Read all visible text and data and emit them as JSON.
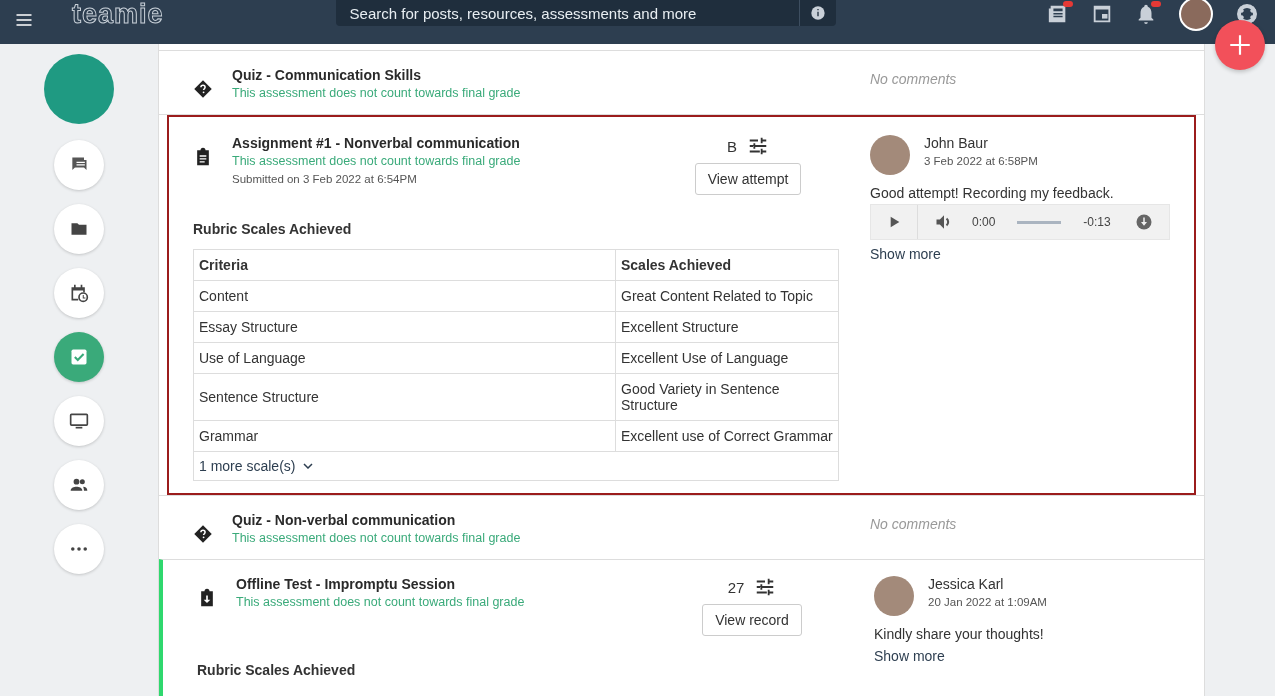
{
  "topbar": {
    "logo": "teamie",
    "search": {
      "placeholder": "Search for posts, resources, assessments and more"
    },
    "icons": [
      {
        "kind": "news",
        "badge": true
      },
      {
        "kind": "window"
      },
      {
        "kind": "bell",
        "badge": true
      },
      {
        "kind": "avatar"
      },
      {
        "kind": "help"
      }
    ]
  },
  "sidebar": {
    "items": [
      {
        "kind": "chat",
        "selected": false
      },
      {
        "kind": "folder",
        "selected": false
      },
      {
        "kind": "calendar",
        "selected": false
      },
      {
        "kind": "check",
        "selected": true
      },
      {
        "kind": "monitor",
        "selected": false
      },
      {
        "kind": "people",
        "selected": false
      },
      {
        "kind": "more",
        "selected": false
      }
    ]
  },
  "assessments": [
    {
      "kind": "quiz",
      "title": "Quiz - Communication Skills",
      "note": "This assessment does not count towards final grade",
      "highlighted": false,
      "accent": false,
      "no_comments": "No comments"
    },
    {
      "kind": "assignment",
      "title": "Assignment #1 - Nonverbal communication",
      "note": "This assessment does not count towards final grade",
      "submitted": "Submitted on 3 Feb 2022 at 6:54PM",
      "grade": "B",
      "action": "View attempt",
      "highlighted": true,
      "accent": false,
      "rubric": {
        "heading": "Rubric Scales Achieved",
        "columns": [
          "Criteria",
          "Scales Achieved"
        ],
        "rows": [
          [
            "Content",
            "Great Content Related to Topic"
          ],
          [
            "Essay Structure",
            "Excellent Structure"
          ],
          [
            "Use of Language",
            "Excellent Use of Language"
          ],
          [
            "Sentence Structure",
            "Good Variety in Sentence Structure"
          ],
          [
            "Grammar",
            "Excellent use of Correct Grammar"
          ]
        ],
        "more": "1 more scale(s)"
      },
      "comment": {
        "author": "John Baur",
        "time": "3 Feb 2022 at 6:58PM",
        "text": "Good attempt! Recording my feedback.",
        "audio": {
          "current": "0:00",
          "remaining": "-0:13"
        },
        "show_more": "Show more"
      }
    },
    {
      "kind": "quiz",
      "title": "Quiz - Non-verbal communication",
      "note": "This assessment does not count towards final grade",
      "highlighted": false,
      "accent": false,
      "no_comments": "No comments"
    },
    {
      "kind": "offline",
      "title": "Offline Test - Impromptu Session",
      "note": "This assessment does not count towards final grade",
      "grade": "27",
      "action": "View record",
      "highlighted": false,
      "accent": true,
      "rubric": {
        "heading": "Rubric Scales Achieved"
      },
      "comment": {
        "author": "Jessica Karl",
        "time": "20 Jan 2022 at 1:09AM",
        "text": "Kindly share your thoughts!",
        "show_more": "Show more"
      }
    }
  ]
}
